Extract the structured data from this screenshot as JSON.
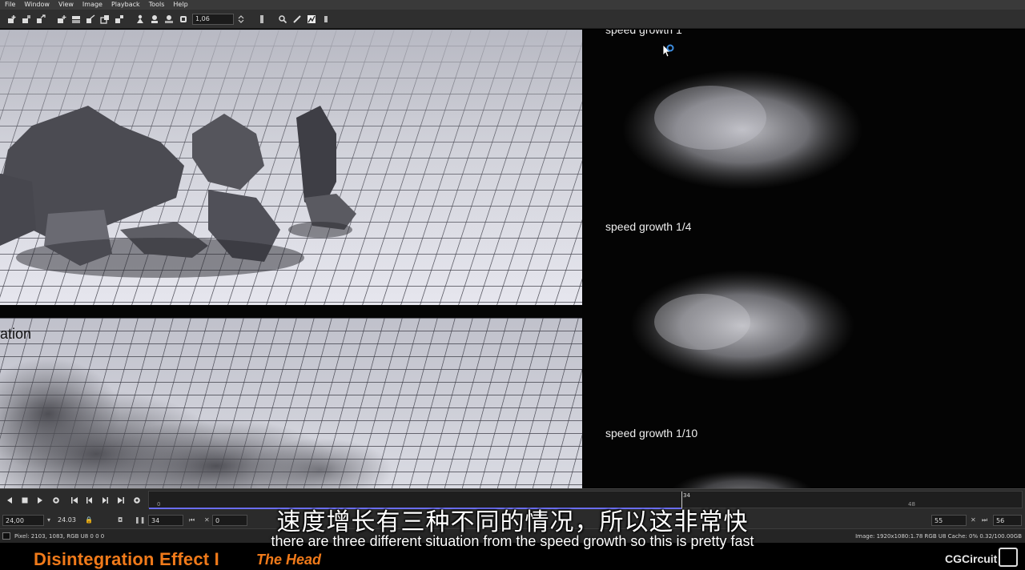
{
  "menu": [
    "File",
    "Window",
    "View",
    "Image",
    "Playback",
    "Tools",
    "Help"
  ],
  "toolbar": {
    "icons": [
      "add-channel-icon",
      "remove-channel-icon",
      "swap-icon",
      "layout-1-icon",
      "layout-2-icon",
      "layout-3-icon",
      "layout-4-icon",
      "layout-5-icon",
      "pan-icon",
      "zoom-icon",
      "fit-icon",
      "exposure-icon",
      "color-picker-icon",
      "magnify-icon",
      "pencil-icon",
      "histogram-icon",
      "settings-icon"
    ],
    "zoom_value": "1,06"
  },
  "viewer": {
    "label_top": "speed growth 1",
    "label_mid": "speed growth 1/4",
    "label_bottom": "speed growth 1/10",
    "side_label": "ation"
  },
  "timeline": {
    "fps_value": "24,00",
    "fps_actual": "24.03",
    "frame_value": "34",
    "offset_value": "0",
    "ruler_ticks": [
      "0",
      "34",
      "48"
    ],
    "current_frame_marker": "34",
    "start_frame": "55",
    "end_frame": "56",
    "playhead_fraction": 0.61,
    "played_fraction": 0.61
  },
  "status": {
    "pixel_info": "Pixel: 2103, 1083, RGB U8 0 0 0",
    "image_info": "Image: 1920x1080:1.78 RGB U8  Cache: 0% 0.32/100.00GB"
  },
  "banner": {
    "title": "Disintegration Effect I",
    "subtitle": "The Head",
    "logo_text": "CGCircuit"
  },
  "subtitles": {
    "chinese": "速度增长有三种不同的情况，所以这非常快",
    "english": "there are three different situation from the speed growth so this is pretty fast"
  }
}
